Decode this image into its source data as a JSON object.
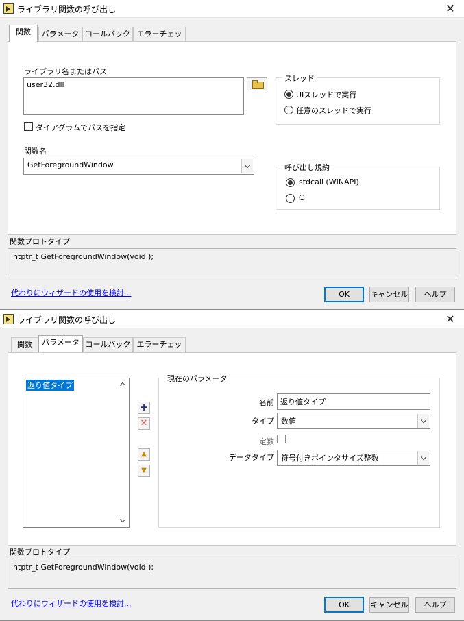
{
  "dialog1": {
    "title": "ライブラリ関数の呼び出し",
    "close": "✕",
    "tabs": [
      "関数",
      "パラメータ",
      "コールバック",
      "エラーチェック"
    ],
    "library_label": "ライブラリ名またはパス",
    "library_value": "user32.dll",
    "diagram_path_label": "ダイアグラムでパスを指定",
    "function_label": "関数名",
    "function_value": "GetForegroundWindow",
    "thread_group": {
      "title": "スレッド",
      "options": [
        "UIスレッドで実行",
        "任意のスレッドで実行"
      ],
      "selected": 0
    },
    "calling_group": {
      "title": "呼び出し規約",
      "options": [
        "stdcall (WINAPI)",
        "C"
      ],
      "selected": 0
    },
    "prototype_label": "関数プロトタイプ",
    "prototype_value": "intptr_t GetForegroundWindow(void );",
    "wizard_link": "代わりにウィザードの使用を検討...",
    "buttons": {
      "ok": "OK",
      "cancel": "キャンセル",
      "help": "ヘルプ"
    }
  },
  "dialog2": {
    "title": "ライブラリ関数の呼び出し",
    "close": "✕",
    "tabs": [
      "関数",
      "パラメータ",
      "コールバック",
      "エラーチェック"
    ],
    "param_list": [
      "返り値タイプ"
    ],
    "current_group": {
      "title": "現在のパラメータ",
      "name_label": "名前",
      "name_value": "返り値タイプ",
      "type_label": "タイプ",
      "type_value": "数値",
      "const_label": "定数",
      "datatype_label": "データタイプ",
      "datatype_value": "符号付きポインタサイズ整数"
    },
    "prototype_label": "関数プロトタイプ",
    "prototype_value": "intptr_t GetForegroundWindow(void );",
    "wizard_link": "代わりにウィザードの使用を検討...",
    "buttons": {
      "ok": "OK",
      "cancel": "キャンセル",
      "help": "ヘルプ"
    }
  }
}
